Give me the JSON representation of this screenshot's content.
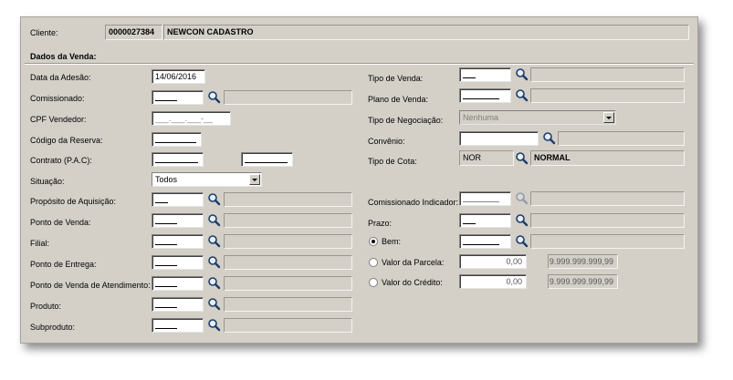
{
  "header": {
    "client_label": "Cliente:",
    "client_code": "0000027384",
    "client_name": "NEWCON CADASTRO"
  },
  "section_title": "Dados da Venda:",
  "left": {
    "data_adesao": {
      "label": "Data da Adesão:",
      "value": "14/06/2016"
    },
    "comissionado": {
      "label": "Comissionado:"
    },
    "cpf_vendedor": {
      "label": "CPF Vendedor:",
      "value": "___.___.___-__"
    },
    "codigo_reserva": {
      "label": "Código da Reserva:"
    },
    "contrato": {
      "label": "Contrato  (P.A.C):"
    },
    "situacao": {
      "label": "Situação:",
      "value": "Todos"
    },
    "proposito": {
      "label": "Propósito de Aquisição:"
    },
    "ponto_venda": {
      "label": "Ponto de Venda:"
    },
    "filial": {
      "label": "Filial:"
    },
    "ponto_entrega": {
      "label": "Ponto de Entrega:"
    },
    "ponto_venda_atendimento": {
      "label": "Ponto de Venda de Atendimento:"
    },
    "produto": {
      "label": "Produto:"
    },
    "subproduto": {
      "label": "Subproduto:"
    }
  },
  "right": {
    "tipo_venda": {
      "label": "Tipo de Venda:"
    },
    "plano_venda": {
      "label": "Plano de Venda:"
    },
    "tipo_negociacao": {
      "label": "Tipo de Negociação:",
      "value": "Nenhuma"
    },
    "convenio": {
      "label": "Convênio:"
    },
    "tipo_cota": {
      "label": "Tipo de Cota:",
      "code": "NOR",
      "desc": "NORMAL"
    },
    "comissionado_indicador": {
      "label": "Comissionado Indicador:"
    },
    "prazo": {
      "label": "Prazo:"
    },
    "bem": {
      "label": "Bem:",
      "selected": true
    },
    "valor_parcela": {
      "label": "Valor da Parcela:",
      "value": "0,00",
      "max": "9.999.999.999,99"
    },
    "valor_credito": {
      "label": "Valor do Crédito:",
      "value": "0,00",
      "max": "9.999.999.999,99"
    }
  }
}
